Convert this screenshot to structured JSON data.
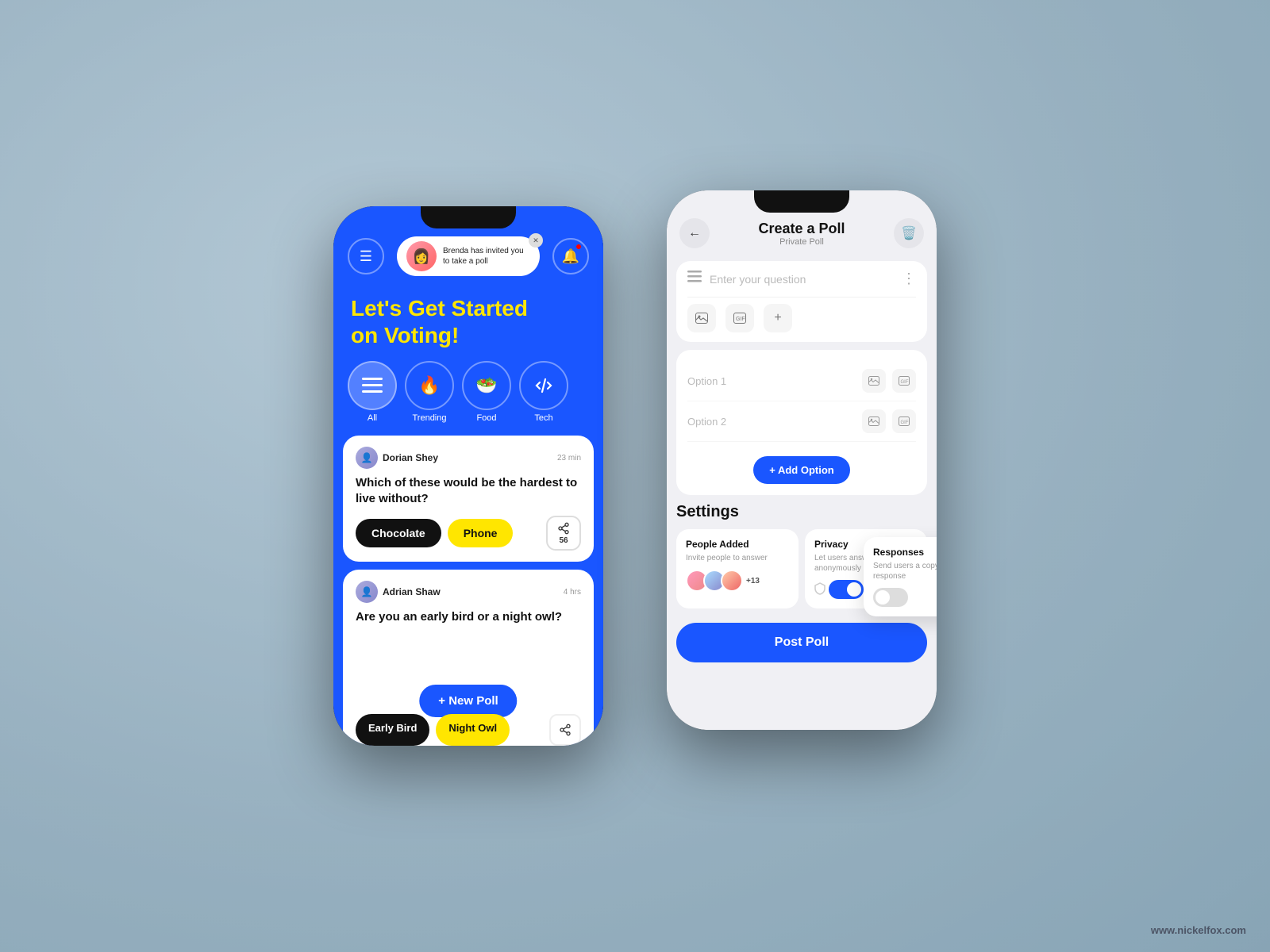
{
  "left_phone": {
    "notification": {
      "text": "Brenda has invited you to take a poll"
    },
    "hero": {
      "line1": "Let's Get Started",
      "line2": "on ",
      "highlight": "Voting!"
    },
    "categories": [
      {
        "id": "all",
        "label": "All",
        "icon": "≡",
        "active": true
      },
      {
        "id": "trending",
        "label": "Trending",
        "icon": "🔥",
        "active": false
      },
      {
        "id": "food",
        "label": "Food",
        "icon": "🥗",
        "active": false
      },
      {
        "id": "tech",
        "label": "Tech",
        "icon": "🔀",
        "active": false
      }
    ],
    "poll1": {
      "username": "Dorian Shey",
      "time": "23 min",
      "question": "Which of these would be the hardest to live without?",
      "option1": "Chocolate",
      "option2": "Phone",
      "share_count": "56"
    },
    "poll2": {
      "username": "Adrian Shaw",
      "time": "4 hrs",
      "question": "Are you an early bird or a night owl?",
      "option1": "Early Bird",
      "option2": "Night Owl"
    },
    "new_poll_btn": "+ New Poll"
  },
  "right_phone": {
    "header": {
      "title": "Create a Poll",
      "subtitle": "Private Poll"
    },
    "question_placeholder": "Enter your question",
    "options": [
      {
        "label": "Option 1"
      },
      {
        "label": "Option 2"
      }
    ],
    "add_option_label": "+ Add Option",
    "settings": {
      "title": "Settings",
      "people_added": {
        "title": "People Added",
        "desc": "Invite people to answer",
        "count": "+13"
      },
      "privacy": {
        "title": "Privacy",
        "desc": "Let users answer anonymously",
        "enabled": true
      },
      "responses": {
        "title": "Responses",
        "desc": "Send users a copy of response",
        "enabled": false
      }
    },
    "post_btn": "Post Poll"
  },
  "watermark": "www.nickelfox.com"
}
